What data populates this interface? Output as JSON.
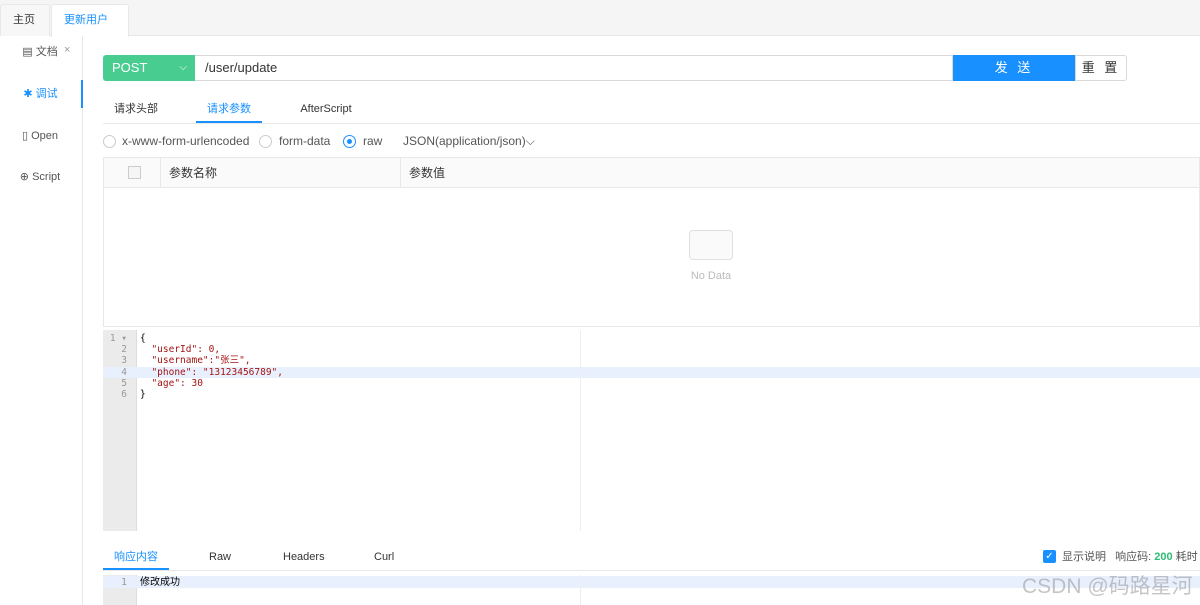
{
  "page_tabs": [
    {
      "label": "主页"
    },
    {
      "label": "更新用户",
      "close": "×"
    }
  ],
  "sidebar": {
    "items": [
      {
        "label": "文档",
        "icon": "document-icon"
      },
      {
        "label": "调试",
        "icon": "bug-icon"
      },
      {
        "label": "Open",
        "icon": "file-icon"
      },
      {
        "label": "Script",
        "icon": "script-icon"
      }
    ]
  },
  "request": {
    "method": "POST",
    "url": "/user/update",
    "send_label": "发 送",
    "reset_label": "重 置"
  },
  "req_tabs": [
    {
      "label": "请求头部"
    },
    {
      "label": "请求参数"
    },
    {
      "label": "AfterScript"
    }
  ],
  "body_types": [
    {
      "label": "x-www-form-urlencoded"
    },
    {
      "label": "form-data"
    },
    {
      "label": "raw"
    }
  ],
  "content_type": "JSON(application/json)",
  "params_table": {
    "headers": [
      "参数名称",
      "参数值"
    ],
    "empty_text": "No Data"
  },
  "editor": {
    "lines": [
      "{",
      "  \"userId\": 0,",
      "  \"username\":\"张三\",",
      "  \"phone\": \"13123456789\",",
      "  \"age\": 30",
      "}"
    ]
  },
  "resp_tabs": [
    {
      "label": "响应内容"
    },
    {
      "label": "Raw"
    },
    {
      "label": "Headers"
    },
    {
      "label": "Curl"
    }
  ],
  "resp_meta": {
    "show_desc": "显示说明",
    "code_label": "响应码:",
    "code": "200",
    "time_label": "耗时"
  },
  "response": {
    "lines": [
      "修改成功"
    ]
  },
  "watermark": "CSDN @码路星河",
  "colors": {
    "accent": "#1890ff",
    "method": "#49cc90",
    "status_ok": "#2dbc74"
  }
}
